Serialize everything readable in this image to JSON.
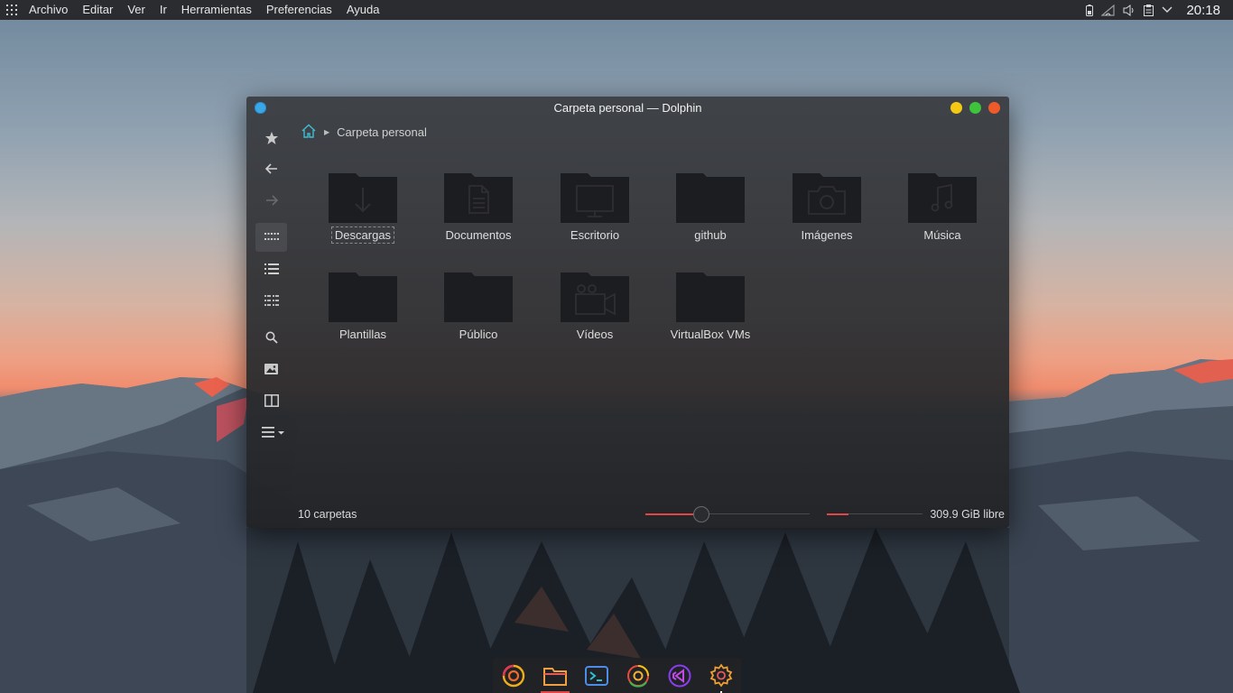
{
  "topbar": {
    "menu": [
      "Archivo",
      "Editar",
      "Ver",
      "Ir",
      "Herramientas",
      "Preferencias",
      "Ayuda"
    ],
    "clock": "20:18",
    "tray_icons": [
      "battery-icon",
      "network-icon",
      "volume-icon",
      "clipboard-icon",
      "chevron-down-icon"
    ]
  },
  "window": {
    "title": "Carpeta personal — Dolphin",
    "breadcrumb": {
      "current": "Carpeta personal"
    },
    "sidebar": [
      "star-icon",
      "back-icon",
      "forward-icon",
      "icons-view-icon",
      "details-view-icon",
      "compact-view-icon",
      "search-icon",
      "preview-icon",
      "split-icon",
      "hamburger-menu-icon"
    ],
    "folders": [
      {
        "label": "Descargas",
        "emblem": "download"
      },
      {
        "label": "Documentos",
        "emblem": "document"
      },
      {
        "label": "Escritorio",
        "emblem": "desktop"
      },
      {
        "label": "github",
        "emblem": "none"
      },
      {
        "label": "Imágenes",
        "emblem": "camera"
      },
      {
        "label": "Música",
        "emblem": "music"
      },
      {
        "label": "Plantillas",
        "emblem": "none"
      },
      {
        "label": "Público",
        "emblem": "none"
      },
      {
        "label": "Vídeos",
        "emblem": "video"
      },
      {
        "label": "VirtualBox VMs",
        "emblem": "none"
      }
    ],
    "status": {
      "count": "10 carpetas",
      "free": "309.9 GiB libre"
    }
  },
  "dock": {
    "apps": [
      "firefox-icon",
      "file-manager-icon",
      "terminal-icon",
      "chrome-icon",
      "vscode-icon",
      "settings-icon"
    ]
  },
  "colors": {
    "accent": "#e24646",
    "panel": "#2a2c30",
    "folder": "#1c1d20",
    "close": "#f05a2a",
    "minimize": "#f5c814",
    "maximize": "#3fc33d"
  }
}
